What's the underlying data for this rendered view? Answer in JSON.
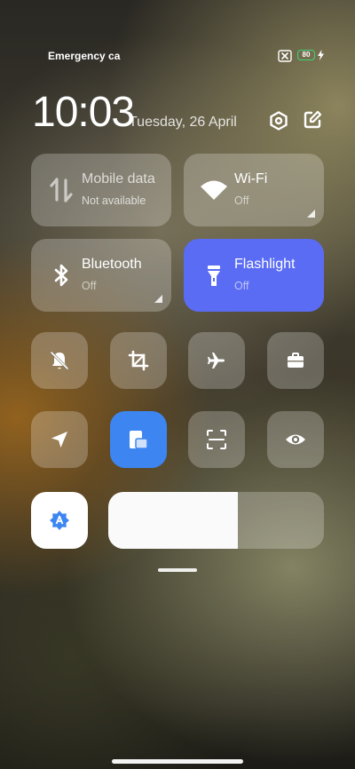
{
  "status_bar": {
    "carrier_text": "Emergency calls only",
    "battery_level": "80",
    "sim_icon": "no-sim-icon",
    "charging_icon": "bolt-icon",
    "battery_color": "#3fd17a"
  },
  "header": {
    "time": "10:03",
    "date": "Tuesday, 26 April",
    "settings_icon": "settings-icon",
    "edit_icon": "edit-icon"
  },
  "tiles": [
    {
      "label": "Mobile data",
      "sub": "Not available",
      "icon": "mobile-data-icon",
      "active": false
    },
    {
      "label": "Wi-Fi",
      "sub": "Off",
      "icon": "wifi-icon",
      "active": false
    },
    {
      "label": "Bluetooth",
      "sub": "Off",
      "icon": "bluetooth-icon",
      "active": false
    },
    {
      "label": "Flashlight",
      "sub": "Off",
      "icon": "flashlight-icon",
      "active": true
    }
  ],
  "quick_buttons": [
    {
      "icon": "silent-bell-icon",
      "active": false
    },
    {
      "icon": "screenshot-crop-icon",
      "active": false
    },
    {
      "icon": "airplane-icon",
      "active": false
    },
    {
      "icon": "briefcase-icon",
      "active": false
    },
    {
      "icon": "location-icon",
      "active": false
    },
    {
      "icon": "floating-window-icon",
      "active": true
    },
    {
      "icon": "scanner-icon",
      "active": false
    },
    {
      "icon": "eye-icon",
      "active": false
    },
    {
      "icon": "auto-brightness-icon",
      "active": true
    }
  ],
  "brightness": {
    "level_percent": 60
  },
  "colors": {
    "accent_flashlight": "#5a6cf4",
    "accent_blue": "#3d86f2"
  }
}
